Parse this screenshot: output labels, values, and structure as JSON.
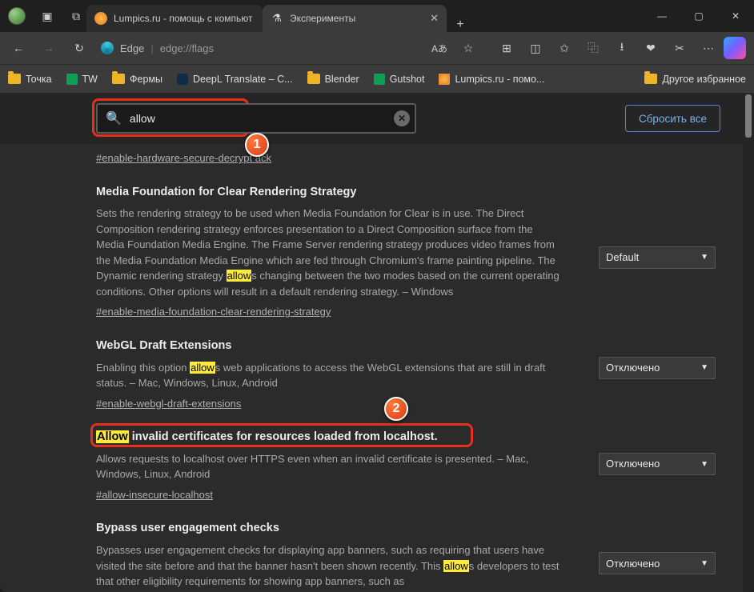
{
  "window": {
    "min": "—",
    "max": "▢",
    "close": "✕"
  },
  "tabs": {
    "inactive": "Lumpics.ru - помощь с компьют",
    "active": "Эксперименты",
    "newtab": "+"
  },
  "toolbar": {
    "edge_label": "Edge",
    "url": "edge://flags",
    "icons": {
      "back": "←",
      "refresh": "↻",
      "read": "Aあ",
      "star": "☆",
      "ext": "⊞",
      "split": "◫",
      "fav": "✩",
      "coll": "⿻",
      "dl": "⭳",
      "perf": "❤",
      "shot": "✂",
      "more": "⋯"
    }
  },
  "bookmarks": {
    "b1": "Точка",
    "b2": "TW",
    "b3": "Фермы",
    "b4": "DeepL Translate – C...",
    "b5": "Blender",
    "b6": "Gutshot",
    "b7": "Lumpics.ru - помо...",
    "other": "Другое избранное"
  },
  "search": {
    "value": "allow",
    "reset": "Сбросить все"
  },
  "flags": {
    "link0": "#enable-hardware-secure-decrypt           ack",
    "f1": {
      "title": "Media Foundation for Clear Rendering Strategy",
      "desc_a": "Sets the rendering strategy to be used when Media Foundation for Clear is in use. The Direct Composition rendering strategy enforces presentation to a Direct Composition surface from the Media Foundation Media Engine. The Frame Server rendering strategy produces video frames from the Media Foundation Media Engine which are fed through Chromium's frame painting pipeline. The Dynamic rendering strategy ",
      "hl": "allow",
      "desc_b": "s changing between the two modes based on the current operating conditions. Other options will result in a default rendering strategy. – Windows",
      "link": "#enable-media-foundation-clear-rendering-strategy",
      "dropdown": "Default"
    },
    "f2": {
      "title": "WebGL Draft Extensions",
      "desc_a": "Enabling this option ",
      "hl": "allow",
      "desc_b": "s web applications to access the WebGL extensions that are still in draft status. – Mac, Windows, Linux, Android",
      "link": "#enable-webgl-draft-extensions",
      "dropdown": "Отключено"
    },
    "f3": {
      "title_hl": "Allow",
      "title_rest": " invalid certificates for resources loaded from localhost.",
      "desc": "Allows requests to localhost over HTTPS even when an invalid certificate is presented. – Mac, Windows, Linux, Android",
      "link": "#allow-insecure-localhost",
      "dropdown": "Отключено"
    },
    "f4": {
      "title": "Bypass user engagement checks",
      "desc_a": "Bypasses user engagement checks for displaying app banners, such as requiring that users have visited the site before and that the banner hasn't been shown recently. This ",
      "hl": "allow",
      "desc_b": "s developers to test that other eligibility requirements for showing app banners, such as",
      "dropdown": "Отключено"
    }
  },
  "callouts": {
    "c1": "1",
    "c2": "2"
  }
}
